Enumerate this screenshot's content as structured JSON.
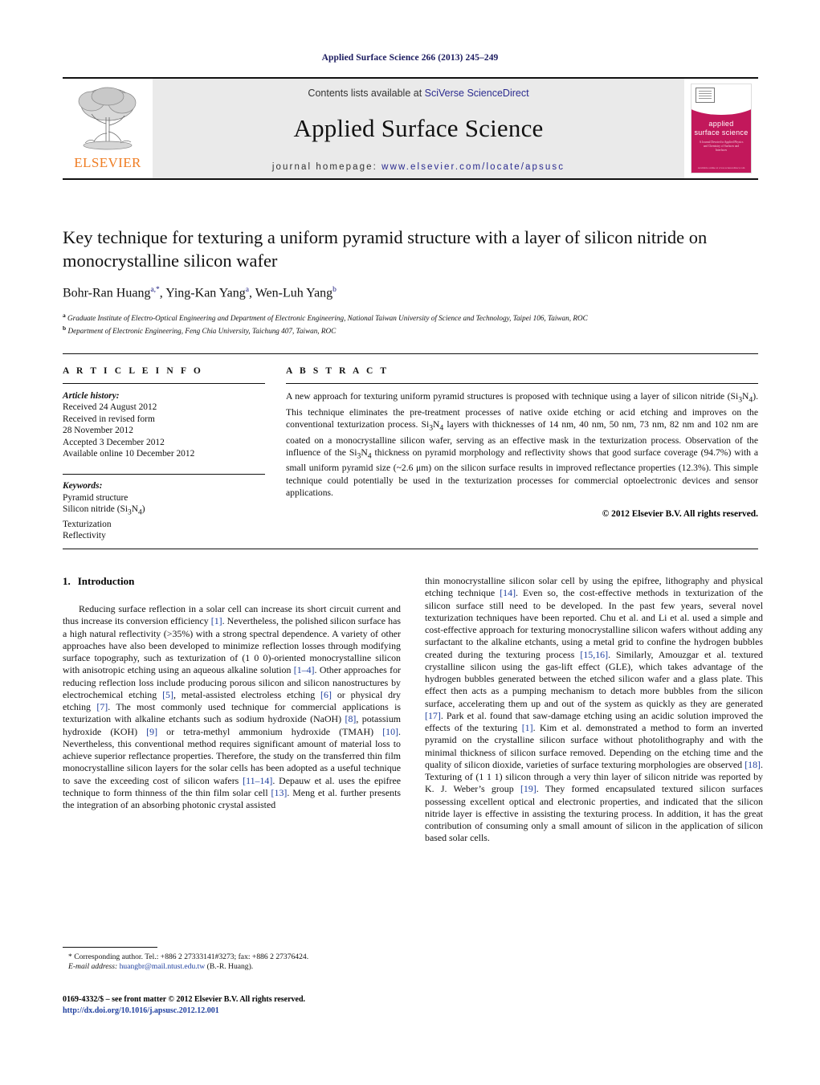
{
  "running_head": "Applied Surface Science 266 (2013) 245–249",
  "journal_header": {
    "publisher_name": "ELSEVIER",
    "contents_prefix": "Contents lists available at ",
    "contents_link": "SciVerse ScienceDirect",
    "journal_title": "Applied Surface Science",
    "homepage_label": "journal homepage: ",
    "homepage_url": "www.elsevier.com/locate/apsusc",
    "cover": {
      "title_line1": "applied",
      "title_line2": "surface science",
      "subtitle": "A Journal Devoted to Applied Physics and Chemistry of Surfaces and Interfaces",
      "footer": "Available online at www.sciencedirect.com"
    }
  },
  "title": "Key technique for texturing a uniform pyramid structure with a layer of silicon nitride on monocrystalline silicon wafer",
  "authors": [
    {
      "name": "Bohr-Ran Huang",
      "marks": "a,*"
    },
    {
      "name": "Ying-Kan Yang",
      "marks": "a"
    },
    {
      "name": "Wen-Luh Yang",
      "marks": "b"
    }
  ],
  "affiliations": [
    {
      "mark": "a",
      "text": "Graduate Institute of Electro-Optical Engineering and Department of Electronic Engineering, National Taiwan University of Science and Technology, Taipei 106, Taiwan, ROC"
    },
    {
      "mark": "b",
      "text": "Department of Electronic Engineering, Feng Chia University, Taichung 407, Taiwan, ROC"
    }
  ],
  "article_info": {
    "heading": "A R T I C L E   I N F O",
    "history_label": "Article history:",
    "history": [
      "Received 24 August 2012",
      "Received in revised form",
      "28 November 2012",
      "Accepted 3 December 2012",
      "Available online 10 December 2012"
    ],
    "keywords_label": "Keywords:",
    "keywords": [
      "Pyramid structure",
      "Silicon nitride (Si3N4)",
      "Texturization",
      "Reflectivity"
    ]
  },
  "abstract": {
    "heading": "A B S T R A C T",
    "text": "A new approach for texturing uniform pyramid structures is proposed with technique using a layer of silicon nitride (Si3N4). This technique eliminates the pre-treatment processes of native oxide etching or acid etching and improves on the conventional texturization process. Si3N4 layers with thicknesses of 14 nm, 40 nm, 50 nm, 73 nm, 82 nm and 102 nm are coated on a monocrystalline silicon wafer, serving as an effective mask in the texturization process. Observation of the influence of the Si3N4 thickness on pyramid morphology and reflectivity shows that good surface coverage (94.7%) with a small uniform pyramid size (~2.6 μm) on the silicon surface results in improved reflectance properties (12.3%). This simple technique could potentially be used in the texturization processes for commercial optoelectronic devices and sensor applications.",
    "copyright": "© 2012 Elsevier B.V. All rights reserved."
  },
  "section": {
    "number": "1.",
    "title": "Introduction"
  },
  "body": {
    "left_paragraph": "Reducing surface reflection in a solar cell can increase its short circuit current and thus increase its conversion efficiency [1]. Nevertheless, the polished silicon surface has a high natural reflectivity (>35%) with a strong spectral dependence. A variety of other approaches have also been developed to minimize reflection losses through modifying surface topography, such as texturization of (1 0 0)-oriented monocrystalline silicon with anisotropic etching using an aqueous alkaline solution [1–4]. Other approaches for reducing reflection loss include producing porous silicon and silicon nanostructures by electrochemical etching [5], metal-assisted electroless etching [6] or physical dry etching [7]. The most commonly used technique for commercial applications is texturization with alkaline etchants such as sodium hydroxide (NaOH) [8], potassium hydroxide (KOH) [9] or tetra-methyl ammonium hydroxide (TMAH) [10]. Nevertheless, this conventional method requires significant amount of material loss to achieve superior reflectance properties. Therefore, the study on the transferred thin film monocrystalline silicon layers for the solar cells has been adopted as a useful technique to save the exceeding cost of silicon wafers [11–14]. Depauw et al. uses the epifree technique to form thinness of the thin film solar cell [13]. Meng et al. further presents the integration of an absorbing photonic crystal assisted",
    "right_paragraph": "thin monocrystalline silicon solar cell by using the epifree, lithography and physical etching technique [14]. Even so, the cost-effective methods in texturization of the silicon surface still need to be developed. In the past few years, several novel texturization techniques have been reported. Chu et al. and Li et al. used a simple and cost-effective approach for texturing monocrystalline silicon wafers without adding any surfactant to the alkaline etchants, using a metal grid to confine the hydrogen bubbles created during the texturing process [15,16]. Similarly, Amouzgar et al. textured crystalline silicon using the gas-lift effect (GLE), which takes advantage of the hydrogen bubbles generated between the etched silicon wafer and a glass plate. This effect then acts as a pumping mechanism to detach more bubbles from the silicon surface, accelerating them up and out of the system as quickly as they are generated [17]. Park et al. found that saw-damage etching using an acidic solution improved the effects of the texturing [1]. Kim et al. demonstrated a method to form an inverted pyramid on the crystalline silicon surface without photolithography and with the minimal thickness of silicon surface removed. Depending on the etching time and the quality of silicon dioxide, varieties of surface texturing morphologies are observed [18]. Texturing of (1 1 1) silicon through a very thin layer of silicon nitride was reported by K. J. Weber's group [19]. They formed encapsulated textured silicon surfaces possessing excellent optical and electronic properties, and indicated that the silicon nitride layer is effective in assisting the texturing process. In addition, it has the great contribution of consuming only a small amount of silicon in the application of silicon based solar cells."
  },
  "footnotes": {
    "corresponding": "* Corresponding author. Tel.: +886 2 27333141#3273; fax: +886 2 27376424.",
    "email_label": "E-mail address:",
    "email": "huangbr@mail.ntust.edu.tw",
    "email_suffix": "(B.-R. Huang)."
  },
  "footer": {
    "issn_line": "0169-4332/$ – see front matter © 2012 Elsevier B.V. All rights reserved.",
    "doi": "http://dx.doi.org/10.1016/j.apsusc.2012.12.001"
  }
}
